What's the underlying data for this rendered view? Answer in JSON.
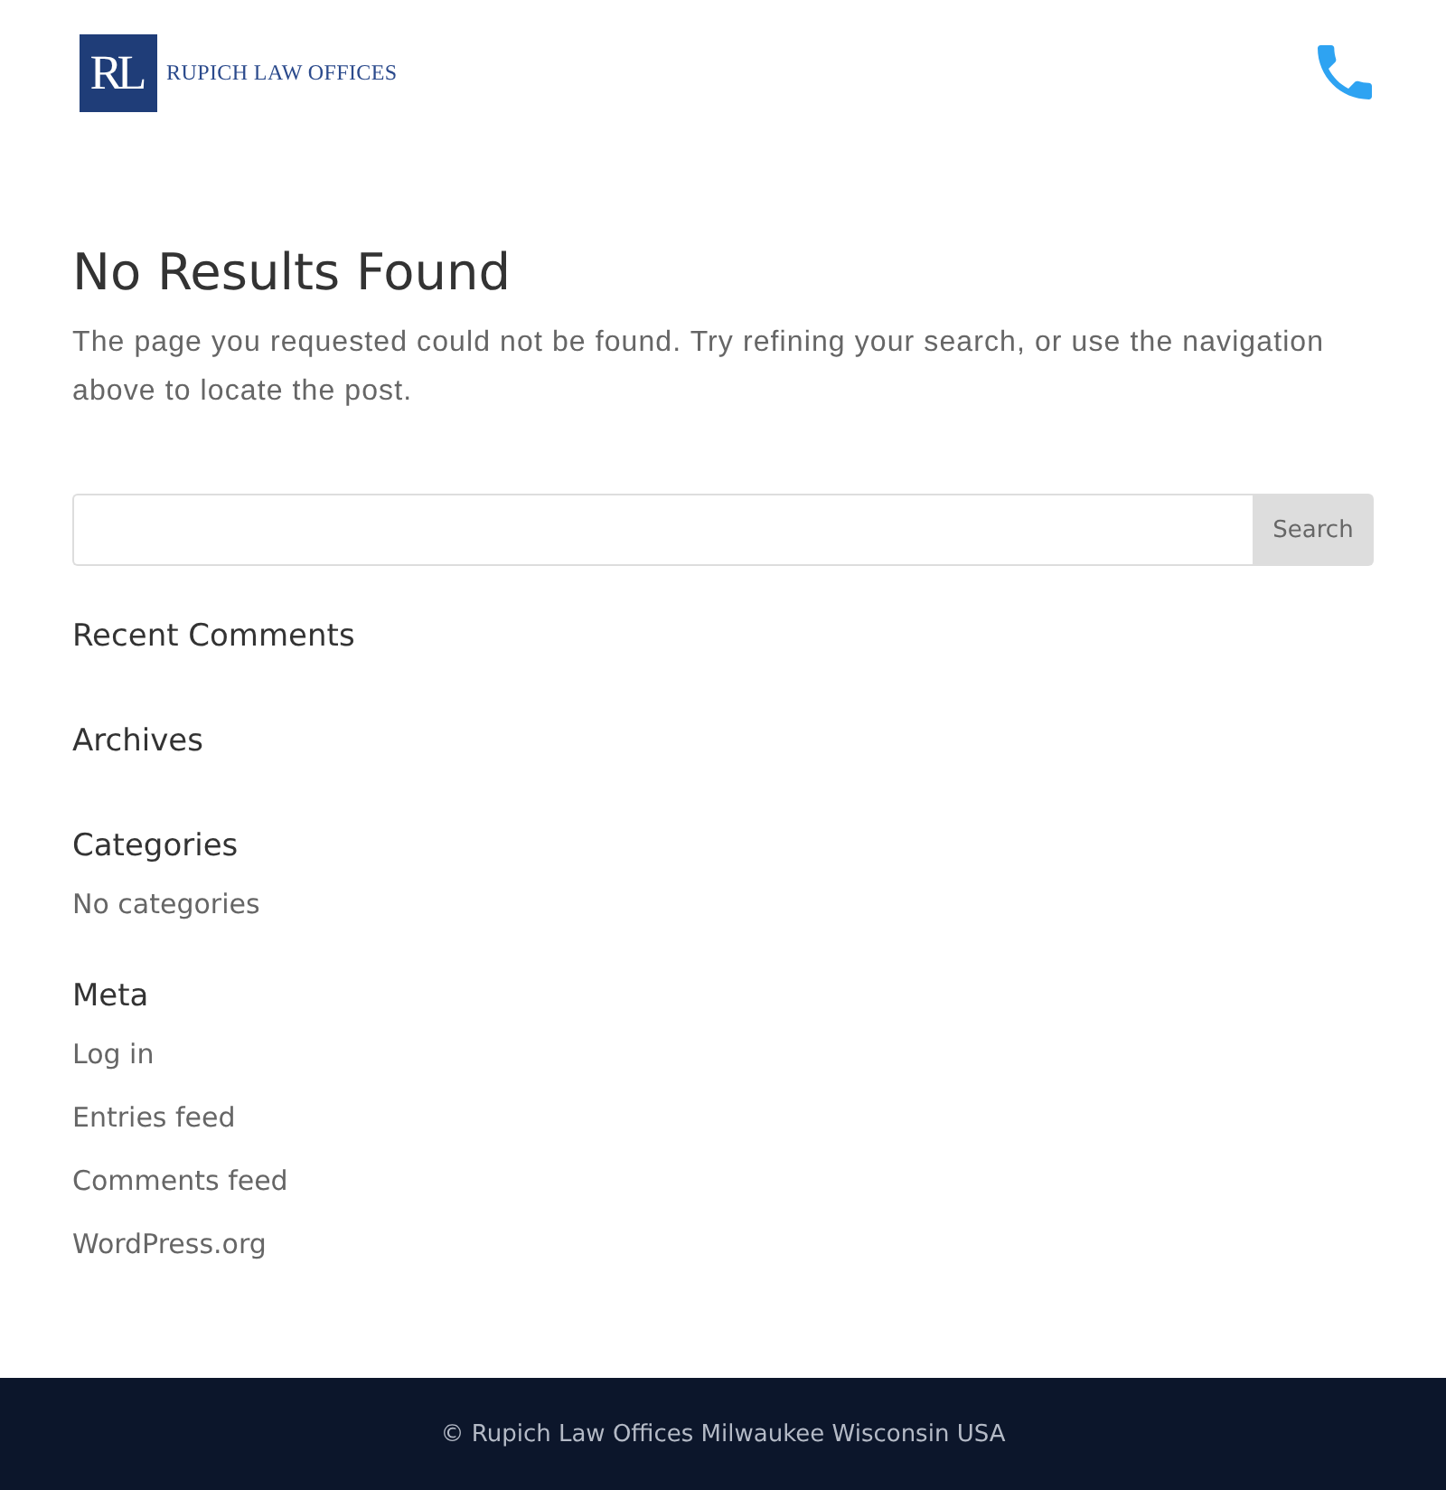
{
  "header": {
    "logo": {
      "monogram": "RL",
      "name": "RUPICH LAW OFFICES"
    }
  },
  "main": {
    "title": "No Results Found",
    "message": "The page you requested could not be found. Try refining your search, or use the navigation above to locate the post."
  },
  "search": {
    "button": "Search"
  },
  "widgets": [
    {
      "title": "Recent Comments"
    },
    {
      "title": "Archives"
    },
    {
      "title": "Categories",
      "items": [
        "No categories"
      ]
    },
    {
      "title": "Meta",
      "links": [
        "Log in",
        "Entries feed",
        "Comments feed",
        "WordPress.org"
      ]
    }
  ],
  "footer": {
    "text": "© Rupich Law Offices Milwaukee Wisconsin USA"
  }
}
